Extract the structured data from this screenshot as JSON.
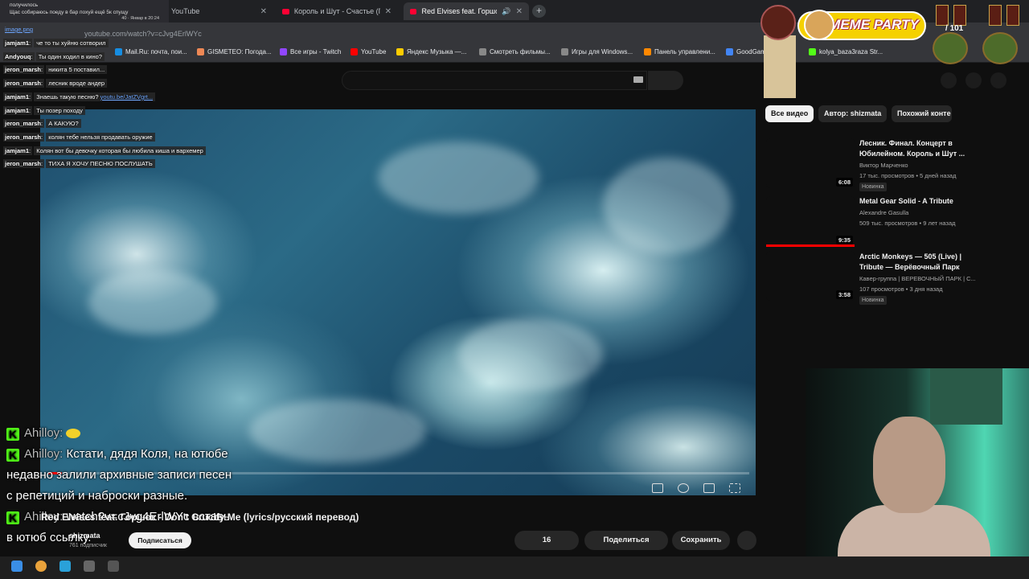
{
  "browser": {
    "tabs": [
      {
        "label": "YouTube",
        "active": false
      },
      {
        "label": "Король и Шут - Счастье (Пос",
        "active": false
      },
      {
        "label": "Red Elvises feat. Горшок - I",
        "active": true
      }
    ],
    "url": "youtube.com/watch?v=cJvg4ErlWYc",
    "bookmarks": [
      "Mail.Ru: почта, пои...",
      "GISMETEO: Погода...",
      "Все игры - Twitch",
      "YouTube",
      "Яндекс Музыка —...",
      "Смотреть фильмы...",
      "Игры для Windows...",
      "Панель управлени...",
      "GoodGam",
      "kolya_baza3raza Str..."
    ]
  },
  "notification": {
    "line1": "получилось",
    "line2": "Щас собираюсь поеду в бар похуй ещё 5к спущу",
    "time": "40 · Январ в 20:24"
  },
  "image_link": "image.png",
  "overlay_chat": [
    {
      "user": "jamjam1",
      "msg": "че то ты хуйню сотворил"
    },
    {
      "user": "Andyouq",
      "msg": "Ты один ходил в кино?"
    },
    {
      "user": "jeron_marsh",
      "msg": "никита 5 поставил..."
    },
    {
      "user": "jeron_marsh",
      "msg": "лесник вроде андер"
    },
    {
      "user": "jamjam1",
      "msg": "Знаешь такую песню?",
      "link": "youtu.be/JatZVgrt..."
    },
    {
      "user": "jamjam1",
      "msg": "Ты позер походу"
    },
    {
      "user": "jeron_marsh",
      "msg": "А КАКУЮ?"
    },
    {
      "user": "jeron_marsh",
      "msg": "колян тебе нельзя продавать оружие"
    },
    {
      "user": "jamjam1",
      "msg": "Колян вот бы девочку которая бы любила киша и вархемер"
    },
    {
      "user": "jeron_marsh",
      "msg": "ТИХА Я ХОЧУ ПЕСНЮ ПОСЛУШАТЬ"
    }
  ],
  "big_chat": {
    "line1_user": "Ahilloy:",
    "line2_user": "Ahilloy:",
    "line2_msg": "Кстати, дядя Коля, на ютюбе",
    "line3": "недавно залили архивные записи песен",
    "line4": "с репетиций и наброски разные.",
    "line5_user": "Ahilloy:",
    "line5_msg": "watch?v=cJvg4ErlWYc вставь",
    "line6": "в ютюб ссылку."
  },
  "video": {
    "title": "Red Elvises feat. Горшок - Don't Crucify Me (lyrics/русский перевод)",
    "channel": "shizmata",
    "subscribers": "761 подписчик",
    "subscribe_label": "Подписаться",
    "likes": "16",
    "share_label": "Поделиться",
    "save_label": "Сохранить",
    "progress": 0.02
  },
  "chips": [
    "Все видео",
    "Автор: shizmata",
    "Похожий конте"
  ],
  "related": [
    {
      "title": "Лесник. Финал. Концерт в Юбилейном. Король и Шут ...",
      "author": "Виктор Марченко",
      "meta": "17 тыс. просмотров • 5 дней назад",
      "badge": "Новинка",
      "duration": "6:08"
    },
    {
      "title": "Metal Gear Solid - A Tribute",
      "author": "Alexandre Gasulla",
      "meta": "509 тыс. просмотров • 9 лет назад",
      "badge": "",
      "duration": "9:35"
    },
    {
      "title": "Arctic Monkeys — 505 (Live) | Tribute — Верёвочный Парк",
      "author": "Кавер-группа | ВЕРЕВОЧНЫЙ ПАРК | С...",
      "meta": "107 просмотров • 3 дня назад",
      "badge": "Новинка",
      "duration": "3:58"
    }
  ],
  "widget": {
    "meme_title": "MEME PARTY",
    "level": "101"
  }
}
